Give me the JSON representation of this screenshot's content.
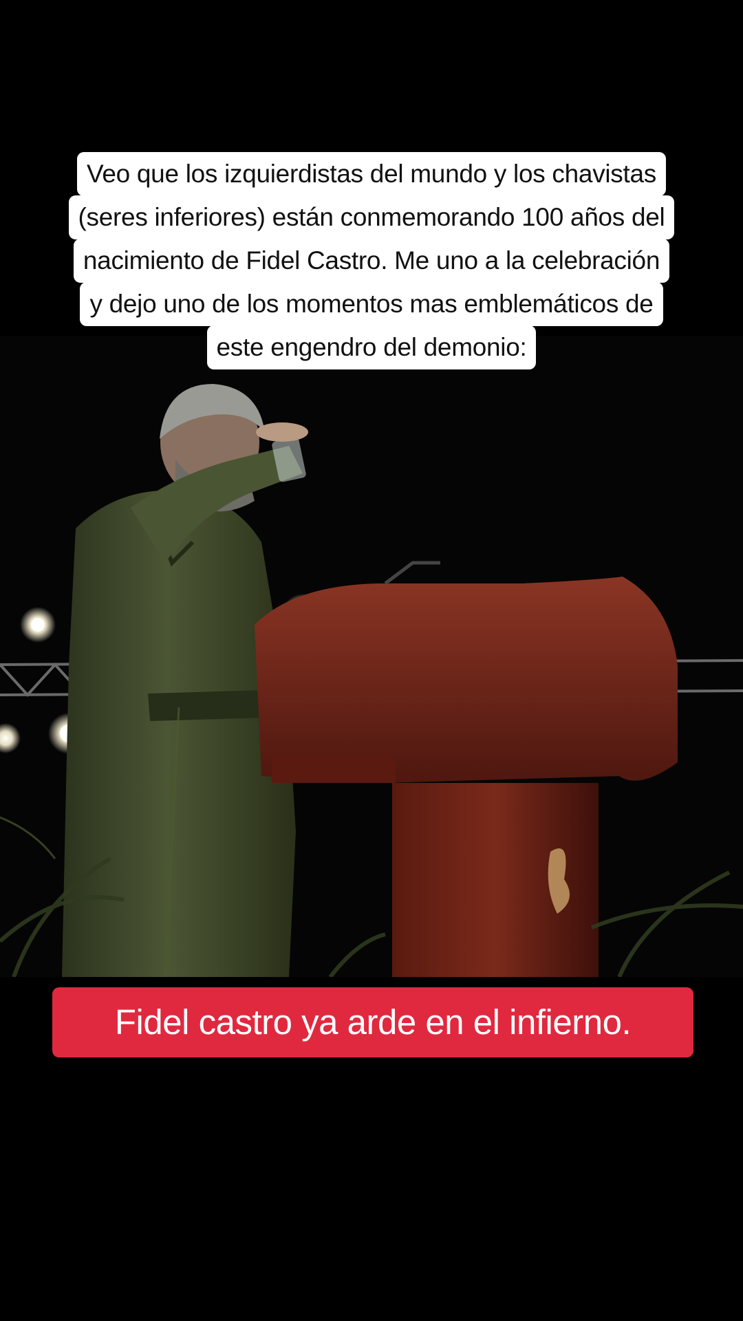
{
  "caption_top": {
    "lines": [
      "Veo que los izquierdistas del mundo y los chavistas",
      "(seres inferiores) están conmemorando 100 años del",
      "nacimiento de Fidel Castro. Me uno a la celebración",
      "y dejo uno de los momentos mas emblemáticos de",
      "este engendro del demonio:"
    ],
    "background": "#ffffff",
    "text_color": "#111111"
  },
  "caption_bottom": {
    "text": "Fidel castro ya arde en el infierno.",
    "background": "#e0293f",
    "text_color": "#ffffff"
  },
  "video": {
    "scene": "man-in-olive-uniform-drinking-at-wooden-podium",
    "colors": {
      "background": "#050505",
      "uniform": "#3f4a2a",
      "podium": "#6b2418",
      "lights": "#fff8e0"
    }
  }
}
